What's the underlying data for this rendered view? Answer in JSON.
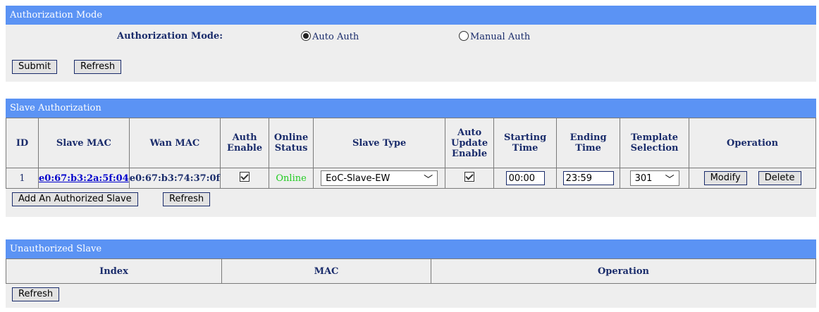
{
  "auth_mode": {
    "title": "Authorization Mode",
    "label": "Authorization Mode:",
    "options": [
      {
        "label": "Auto Auth",
        "selected": true
      },
      {
        "label": "Manual Auth",
        "selected": false
      }
    ],
    "submit_label": "Submit",
    "refresh_label": "Refresh"
  },
  "slave_auth": {
    "title": "Slave Authorization",
    "columns": [
      "ID",
      "Slave MAC",
      "Wan MAC",
      "Auth Enable",
      "Online Status",
      "Slave Type",
      "Auto Update Enable",
      "Starting Time",
      "Ending Time",
      "Template Selection",
      "Operation"
    ],
    "rows": [
      {
        "id": "1",
        "slave_mac": "e0:67:b3:2a:5f:04",
        "wan_mac": "e0:67:b3:74:37:0f",
        "auth_enable": true,
        "online_status": "Online",
        "slave_type": "EoC-Slave-EW",
        "auto_update": true,
        "start_time": "00:00",
        "end_time": "23:59",
        "template": "301",
        "modify_label": "Modify",
        "delete_label": "Delete"
      }
    ],
    "add_label": "Add An Authorized Slave",
    "refresh_label": "Refresh"
  },
  "unauth": {
    "title": "Unauthorized Slave",
    "columns": [
      "Index",
      "MAC",
      "Operation"
    ],
    "refresh_label": "Refresh"
  },
  "colors": {
    "header": "#5b93f4",
    "panel": "#eeeeee",
    "text": "#1a2c6b",
    "online": "#22cc22",
    "link": "#0000cc"
  }
}
